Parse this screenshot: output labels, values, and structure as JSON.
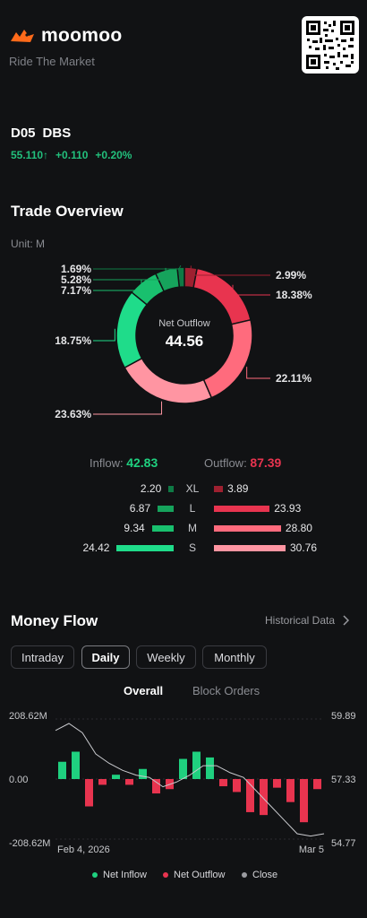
{
  "brand": {
    "name": "moomoo",
    "tagline": "Ride The Market"
  },
  "stock": {
    "code": "D05",
    "name": "DBS",
    "price": "55.110",
    "change": "+0.110",
    "change_pct": "+0.20%"
  },
  "trade_overview": {
    "title": "Trade Overview",
    "unit": "Unit: M",
    "center_label": "Net Outflow",
    "center_value": "44.56",
    "inflow_label": "Inflow:",
    "inflow_value": "42.83",
    "outflow_label": "Outflow:",
    "outflow_value": "87.39",
    "rows": [
      {
        "size": "XL",
        "inflow": "2.20",
        "outflow": "3.89"
      },
      {
        "size": "L",
        "inflow": "6.87",
        "outflow": "23.93"
      },
      {
        "size": "M",
        "inflow": "9.34",
        "outflow": "28.80"
      },
      {
        "size": "S",
        "inflow": "24.42",
        "outflow": "30.76"
      }
    ],
    "colors": {
      "inflow": "#1fd07f",
      "outflow": "#e8344f"
    }
  },
  "money_flow": {
    "title": "Money Flow",
    "link": "Historical Data",
    "tabs": [
      "Intraday",
      "Daily",
      "Weekly",
      "Monthly"
    ],
    "active_tab": "Daily",
    "subtabs": [
      "Overall",
      "Block Orders"
    ],
    "active_subtab": "Overall",
    "legend": {
      "inflow": "Net Inflow",
      "outflow": "Net Outflow",
      "close": "Close"
    }
  },
  "chart_data": [
    {
      "type": "pie",
      "subtype": "donut",
      "title": "",
      "slices": [
        {
          "label": "1.69%",
          "value": 1.69,
          "group": "inflow",
          "size": "XL",
          "color": "#0e7a45"
        },
        {
          "label": "5.28%",
          "value": 5.28,
          "group": "inflow",
          "size": "L",
          "color": "#16a35c"
        },
        {
          "label": "7.17%",
          "value": 7.17,
          "group": "inflow",
          "size": "M",
          "color": "#19c06e"
        },
        {
          "label": "18.75%",
          "value": 18.75,
          "group": "inflow",
          "size": "S",
          "color": "#1fdc8a"
        },
        {
          "label": "23.63%",
          "value": 23.63,
          "group": "outflow",
          "size": "S",
          "color": "#ff95a2"
        },
        {
          "label": "22.11%",
          "value": 22.11,
          "group": "outflow",
          "size": "M",
          "color": "#ff6b7d"
        },
        {
          "label": "18.38%",
          "value": 18.38,
          "group": "outflow",
          "size": "L",
          "color": "#e8344f"
        },
        {
          "label": "2.99%",
          "value": 2.99,
          "group": "outflow",
          "size": "XL",
          "color": "#9e2030"
        }
      ]
    },
    {
      "type": "bar",
      "title": "",
      "x_start_label": "Feb 4, 2026",
      "x_end_label": "Mar 5",
      "y_left": {
        "ticks": [
          "208.62M",
          "0.00",
          "-208.62M"
        ],
        "ylim": [
          -208.62,
          208.62
        ]
      },
      "y_right": {
        "ticks": [
          "59.89",
          "57.33",
          "54.77"
        ],
        "ylim": [
          54.77,
          59.89
        ]
      },
      "series": [
        {
          "name": "Net Inflow",
          "kind": "bar",
          "values": [
            60,
            95,
            -95,
            -20,
            15,
            -20,
            35,
            -50,
            -35,
            70,
            95,
            75,
            -25,
            -45,
            -115,
            -125,
            -30,
            -80,
            -150,
            -35
          ]
        },
        {
          "name": "Close",
          "kind": "line",
          "values": [
            59.4,
            59.7,
            59.3,
            58.4,
            58.0,
            57.7,
            57.5,
            57.4,
            57.0,
            57.2,
            57.5,
            57.9,
            57.9,
            57.6,
            57.4,
            56.8,
            56.2,
            55.6,
            55.0,
            54.9,
            55.0
          ]
        }
      ]
    }
  ]
}
